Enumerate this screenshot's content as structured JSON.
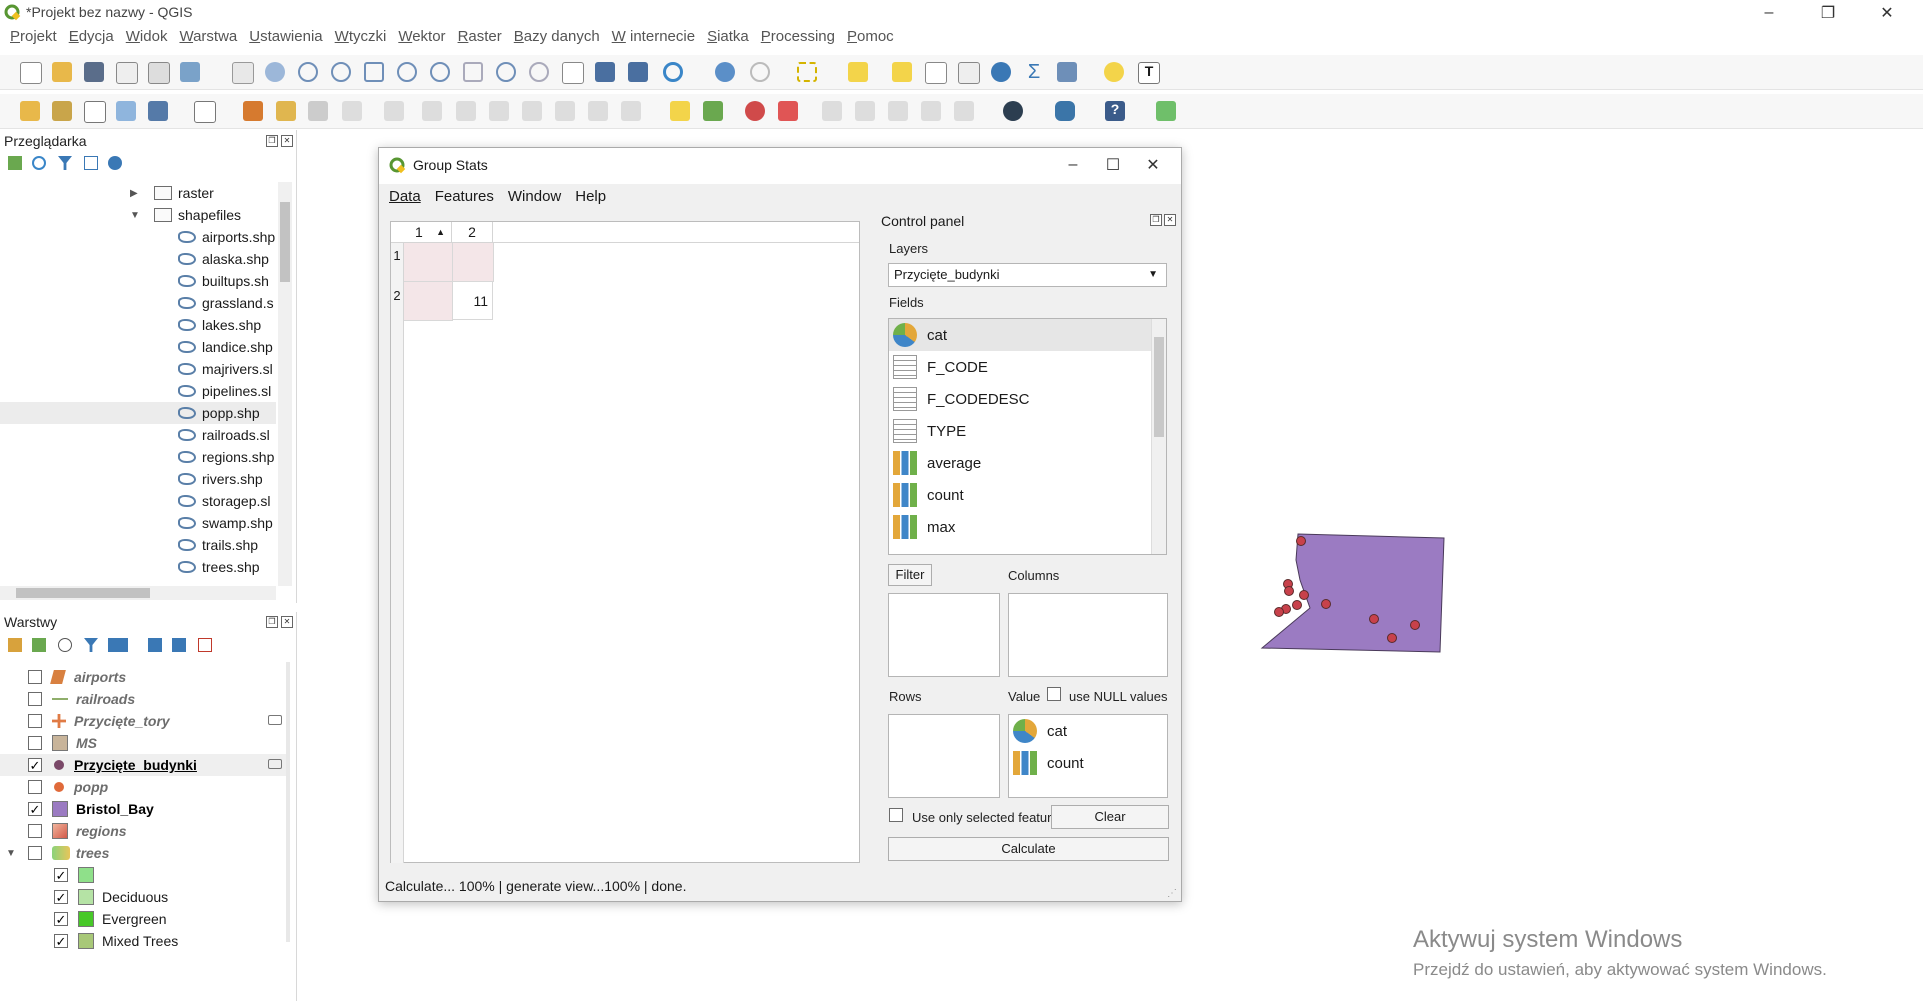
{
  "app": {
    "title": "*Projekt bez nazwy - QGIS"
  },
  "window_controls": {
    "minimize": "–",
    "restore": "❐",
    "close": "✕"
  },
  "menu": [
    "Projekt",
    "Edycja",
    "Widok",
    "Warstwa",
    "Ustawienia",
    "Wtyczki",
    "Wektor",
    "Raster",
    "Bazy danych",
    "W internecie",
    "Siatka",
    "Processing",
    "Pomoc"
  ],
  "browser": {
    "title": "Przeglądarka",
    "folders": [
      "raster",
      "shapefiles"
    ],
    "files": [
      "airports.shp",
      "alaska.shp",
      "builtups.sh",
      "grassland.s",
      "lakes.shp",
      "landice.shp",
      "majrivers.sl",
      "pipelines.sl",
      "popp.shp",
      "railroads.sl",
      "regions.shp",
      "rivers.shp",
      "storagep.sl",
      "swamp.shp",
      "trails.shp",
      "trees.shp"
    ]
  },
  "layers": {
    "title": "Warstwy",
    "items": [
      {
        "name": "airports",
        "checked": false
      },
      {
        "name": "railroads",
        "checked": false
      },
      {
        "name": "Przycięte_tory",
        "checked": false
      },
      {
        "name": "MS",
        "checked": false
      },
      {
        "name": "Przycięte_budynki",
        "checked": true
      },
      {
        "name": "popp",
        "checked": false
      },
      {
        "name": "Bristol_Bay",
        "checked": true
      },
      {
        "name": "regions",
        "checked": false
      },
      {
        "name": "trees",
        "checked": false
      }
    ],
    "tree_classes": [
      "",
      "Deciduous",
      "Evergreen",
      "Mixed Trees"
    ],
    "check_mark": "✓"
  },
  "dialog": {
    "title": "Group Stats",
    "menu": [
      "Data",
      "Features",
      "Window",
      "Help"
    ],
    "table": {
      "col_headers": [
        "1",
        "2"
      ],
      "row_headers": [
        "1",
        "2"
      ],
      "sort_arrow": "▲",
      "cell_value": "11"
    },
    "control_panel": "Control panel",
    "layers_label": "Layers",
    "layer_selected": "Przycięte_budynki",
    "fields_label": "Fields",
    "fields": [
      "cat",
      "F_CODE",
      "F_CODEDESC",
      "TYPE",
      "average",
      "count",
      "max"
    ],
    "filter_button": "Filter",
    "columns_label": "Columns",
    "rows_label": "Rows",
    "value_label": "Value",
    "use_null_label": "use NULL values",
    "value_items": [
      "cat",
      "count"
    ],
    "use_selected_label": "Use only selected features",
    "clear_button": "Clear",
    "calculate_button": "Calculate",
    "status": "Calculate... 100% |  generate view...100% |  done."
  },
  "watermark": {
    "line1": "Aktywuj system Windows",
    "line2": "Przejdź do ustawień, aby aktywować system Windows."
  },
  "colors": {
    "polygon": "#9b7bc2",
    "point": "#c8414b"
  }
}
